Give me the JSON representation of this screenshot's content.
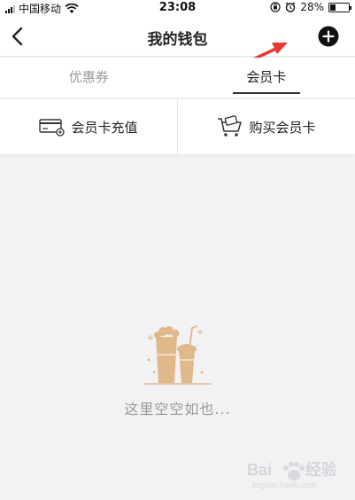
{
  "status_bar": {
    "carrier": "中国移动",
    "time": "23:08",
    "battery_percent": "28%",
    "battery_level": 0.28
  },
  "nav": {
    "title": "我的钱包"
  },
  "tabs": [
    {
      "label": "优惠券",
      "active": false
    },
    {
      "label": "会员卡",
      "active": true
    }
  ],
  "actions": {
    "recharge_label": "会员卡充值",
    "buy_label": "购买会员卡"
  },
  "empty_state": {
    "text": "这里空空如也..."
  },
  "colors": {
    "accent_arrow": "#e53935",
    "illustration": "#e0b98b",
    "background": "#f2f2f4"
  }
}
